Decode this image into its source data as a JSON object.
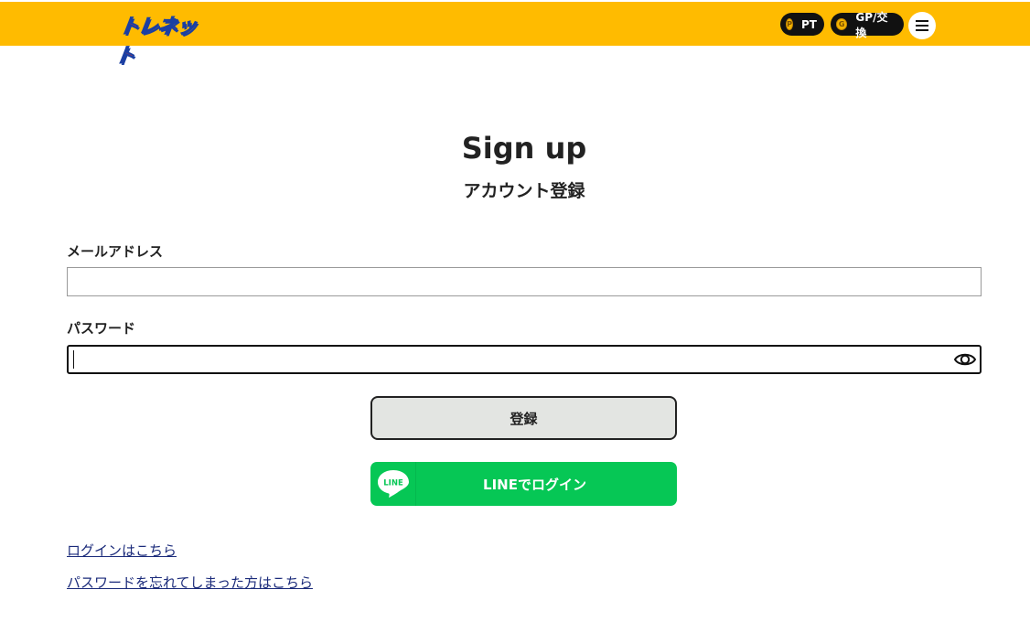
{
  "header": {
    "logo_text": "トレネット",
    "points_label": "PT",
    "coin_glyph": "P",
    "gp_label": "GP/交換",
    "gp_glyph": "G",
    "background_color": "#ffbb00"
  },
  "page": {
    "title": "Sign up",
    "subtitle": "アカウント登録"
  },
  "form": {
    "email_label": "メールアドレス",
    "email_value": "",
    "password_label": "パスワード",
    "password_value": "",
    "register_label": "登録",
    "line_label": "LINEでログイン",
    "line_icon_text": "LINE"
  },
  "links": {
    "login": "ログインはこちら",
    "forgot": "パスワードを忘れてしまった方はこちら"
  },
  "icons": {
    "menu": "hamburger-menu-icon",
    "eye": "eye-icon",
    "line": "line-logo-icon"
  }
}
